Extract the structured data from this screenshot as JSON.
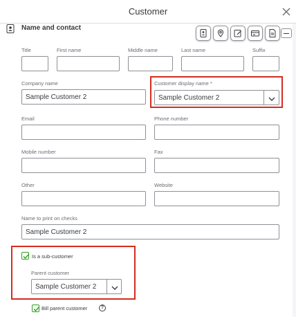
{
  "dialog": {
    "title": "Customer",
    "close_icon": "close-icon"
  },
  "section": {
    "title": "Name and contact",
    "icon": "contact-card-icon"
  },
  "toolbar": {
    "icons": [
      "contact-card-icon",
      "location-pin-icon",
      "edit-note-icon",
      "payment-card-icon",
      "document-icon"
    ]
  },
  "fields": {
    "title": {
      "label": "Title",
      "value": ""
    },
    "first_name": {
      "label": "First name",
      "value": ""
    },
    "middle_name": {
      "label": "Middle name",
      "value": ""
    },
    "last_name": {
      "label": "Last name",
      "value": ""
    },
    "suffix": {
      "label": "Suffix",
      "value": ""
    },
    "company_name": {
      "label": "Company name",
      "value": "Sample Customer 2"
    },
    "display_name": {
      "label": "Customer display name *",
      "value": "Sample Customer 2"
    },
    "email": {
      "label": "Email",
      "value": ""
    },
    "phone": {
      "label": "Phone number",
      "value": ""
    },
    "mobile": {
      "label": "Mobile number",
      "value": ""
    },
    "fax": {
      "label": "Fax",
      "value": ""
    },
    "other": {
      "label": "Other",
      "value": ""
    },
    "website": {
      "label": "Website",
      "value": ""
    },
    "print_on_checks": {
      "label": "Name to print on checks",
      "value": "Sample Customer 2"
    }
  },
  "sub_customer": {
    "checkbox_label": "Is a sub-customer",
    "checked": true,
    "parent_label": "Parent customer",
    "parent_value": "Sample Customer 2"
  },
  "bill_parent": {
    "label": "Bill parent customer",
    "checked": true,
    "help_glyph": "?"
  },
  "colors": {
    "highlight": "#d52b1e",
    "check_green": "#2ca01c",
    "border": "#8d9096",
    "label_gray": "#6b6c72"
  }
}
